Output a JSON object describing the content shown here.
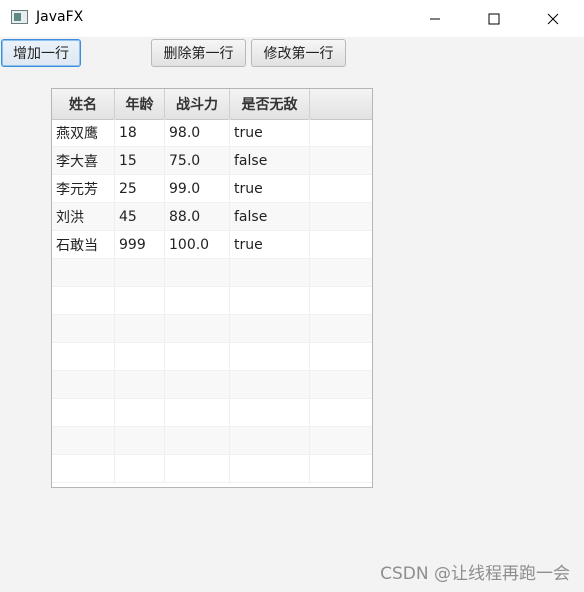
{
  "window": {
    "title": "JavaFX"
  },
  "toolbar": {
    "add_label": "增加一行",
    "delete_label": "删除第一行",
    "edit_label": "修改第一行"
  },
  "table": {
    "columns": [
      "姓名",
      "年龄",
      "战斗力",
      "是否无敌"
    ],
    "rows": [
      [
        "燕双鹰",
        "18",
        "98.0",
        "true"
      ],
      [
        "李大喜",
        "15",
        "75.0",
        "false"
      ],
      [
        "李元芳",
        "25",
        "99.0",
        "true"
      ],
      [
        "刘洪",
        "45",
        "88.0",
        "false"
      ],
      [
        "石敢当",
        "999",
        "100.0",
        "true"
      ]
    ]
  },
  "watermark": "CSDN @让线程再跑一会"
}
